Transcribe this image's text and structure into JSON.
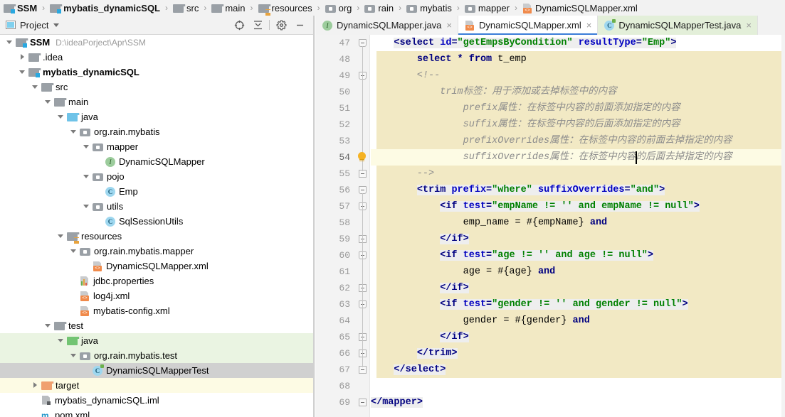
{
  "breadcrumb": {
    "items": [
      {
        "label": "SSM",
        "icon": "module-icon",
        "bold": true
      },
      {
        "label": "mybatis_dynamicSQL",
        "icon": "module-icon",
        "bold": true
      },
      {
        "label": "src",
        "icon": "folder-icon",
        "bold": false
      },
      {
        "label": "main",
        "icon": "folder-icon",
        "bold": false
      },
      {
        "label": "resources",
        "icon": "resource-folder-icon",
        "bold": false
      },
      {
        "label": "org",
        "icon": "package-icon",
        "bold": false
      },
      {
        "label": "rain",
        "icon": "package-icon",
        "bold": false
      },
      {
        "label": "mybatis",
        "icon": "package-icon",
        "bold": false
      },
      {
        "label": "mapper",
        "icon": "package-icon",
        "bold": false
      },
      {
        "label": "DynamicSQLMapper.xml",
        "icon": "xml-file-icon",
        "bold": false
      }
    ],
    "separator": "›"
  },
  "tool_window": {
    "title": "Project",
    "actions": [
      {
        "name": "select-opened-file-icon"
      },
      {
        "name": "collapse-all-icon"
      },
      {
        "name": "settings-gear-icon"
      },
      {
        "name": "hide-icon"
      }
    ]
  },
  "tree": {
    "rows": [
      {
        "indent": 0,
        "arrow": "down",
        "icon": "module-icon",
        "label": "SSM",
        "bold": true,
        "path": "D:\\ideaPorject\\Apr\\SSM",
        "bg": "none"
      },
      {
        "indent": 1,
        "arrow": "right",
        "icon": "folder-icon",
        "label": ".idea",
        "bold": false,
        "path": "",
        "bg": "none"
      },
      {
        "indent": 1,
        "arrow": "down",
        "icon": "module-icon",
        "label": "mybatis_dynamicSQL",
        "bold": true,
        "path": "",
        "bg": "none"
      },
      {
        "indent": 2,
        "arrow": "down",
        "icon": "folder-icon",
        "label": "src",
        "bold": false,
        "path": "",
        "bg": "none"
      },
      {
        "indent": 3,
        "arrow": "down",
        "icon": "folder-icon",
        "label": "main",
        "bold": false,
        "path": "",
        "bg": "none"
      },
      {
        "indent": 4,
        "arrow": "down",
        "icon": "source-folder-icon",
        "label": "java",
        "bold": false,
        "path": "",
        "bg": "none"
      },
      {
        "indent": 5,
        "arrow": "down",
        "icon": "package-icon",
        "label": "org.rain.mybatis",
        "bold": false,
        "path": "",
        "bg": "none"
      },
      {
        "indent": 6,
        "arrow": "down",
        "icon": "package-icon",
        "label": "mapper",
        "bold": false,
        "path": "",
        "bg": "none"
      },
      {
        "indent": 7,
        "arrow": "none",
        "icon": "interface-icon",
        "label": "DynamicSQLMapper",
        "bold": false,
        "path": "",
        "bg": "none"
      },
      {
        "indent": 6,
        "arrow": "down",
        "icon": "package-icon",
        "label": "pojo",
        "bold": false,
        "path": "",
        "bg": "none"
      },
      {
        "indent": 7,
        "arrow": "none",
        "icon": "class-icon",
        "label": "Emp",
        "bold": false,
        "path": "",
        "bg": "none"
      },
      {
        "indent": 6,
        "arrow": "down",
        "icon": "package-icon",
        "label": "utils",
        "bold": false,
        "path": "",
        "bg": "none"
      },
      {
        "indent": 7,
        "arrow": "none",
        "icon": "class-icon",
        "label": "SqlSessionUtils",
        "bold": false,
        "path": "",
        "bg": "none"
      },
      {
        "indent": 4,
        "arrow": "down",
        "icon": "resource-folder-icon",
        "label": "resources",
        "bold": false,
        "path": "",
        "bg": "none"
      },
      {
        "indent": 5,
        "arrow": "down",
        "icon": "package-icon",
        "label": "org.rain.mybatis.mapper",
        "bold": false,
        "path": "",
        "bg": "none"
      },
      {
        "indent": 6,
        "arrow": "none",
        "icon": "xml-file-icon",
        "label": "DynamicSQLMapper.xml",
        "bold": false,
        "path": "",
        "bg": "none"
      },
      {
        "indent": 5,
        "arrow": "none",
        "icon": "properties-file-icon",
        "label": "jdbc.properties",
        "bold": false,
        "path": "",
        "bg": "none"
      },
      {
        "indent": 5,
        "arrow": "none",
        "icon": "xml-file-icon",
        "label": "log4j.xml",
        "bold": false,
        "path": "",
        "bg": "none"
      },
      {
        "indent": 5,
        "arrow": "none",
        "icon": "xml-file-icon",
        "label": "mybatis-config.xml",
        "bold": false,
        "path": "",
        "bg": "none"
      },
      {
        "indent": 3,
        "arrow": "down",
        "icon": "folder-icon",
        "label": "test",
        "bold": false,
        "path": "",
        "bg": "none"
      },
      {
        "indent": 4,
        "arrow": "down",
        "icon": "test-source-folder-icon",
        "label": "java",
        "bold": false,
        "path": "",
        "bg": "green"
      },
      {
        "indent": 5,
        "arrow": "down",
        "icon": "package-icon",
        "label": "org.rain.mybatis.test",
        "bold": false,
        "path": "",
        "bg": "green"
      },
      {
        "indent": 6,
        "arrow": "none",
        "icon": "test-class-icon",
        "label": "DynamicSQLMapperTest",
        "bold": false,
        "path": "",
        "bg": "selected"
      },
      {
        "indent": 2,
        "arrow": "right",
        "icon": "excluded-folder-icon",
        "label": "target",
        "bold": false,
        "path": "",
        "bg": "yellow"
      },
      {
        "indent": 2,
        "arrow": "none",
        "icon": "iml-file-icon",
        "label": "mybatis_dynamicSQL.iml",
        "bold": false,
        "path": "",
        "bg": "none"
      },
      {
        "indent": 2,
        "arrow": "none",
        "icon": "maven-file-icon",
        "label": "pom.xml",
        "bold": false,
        "path": "",
        "bg": "none"
      }
    ]
  },
  "editor_tabs": [
    {
      "label": "DynamicSQLMapper.java",
      "icon": "interface-icon",
      "state": "inactive",
      "close": "×"
    },
    {
      "label": "DynamicSQLMapper.xml",
      "icon": "xml-file-icon",
      "state": "active",
      "close": "×"
    },
    {
      "label": "DynamicSQLMapperTest.java",
      "icon": "test-class-icon",
      "state": "highlight",
      "close": "×"
    }
  ],
  "editor": {
    "first_line_number": 47,
    "last_line_number": 69,
    "caret": {
      "line": 54,
      "column_label": ""
    },
    "intention_bulb_line": 54,
    "lines": [
      {
        "n": 47,
        "text": "    <select id=\"getEmpsByCondition\" resultType=\"Emp\">"
      },
      {
        "n": 48,
        "text": "        select * from t_emp"
      },
      {
        "n": 49,
        "text": "        <!--"
      },
      {
        "n": 50,
        "text": "            trim标签：用于添加或去掉标签中的内容"
      },
      {
        "n": 51,
        "text": "                prefix属性：在标签中内容的前面添加指定的内容"
      },
      {
        "n": 52,
        "text": "                suffix属性：在标签中内容的后面添加指定的内容"
      },
      {
        "n": 53,
        "text": "                prefixOverrides属性：在标签中内容的前面去掉指定的内容"
      },
      {
        "n": 54,
        "text": "                suffixOverrides属性：在标签中内容的后面去掉指定的内容"
      },
      {
        "n": 55,
        "text": "        -->"
      },
      {
        "n": 56,
        "text": "        <trim prefix=\"where\" suffixOverrides=\"and\">"
      },
      {
        "n": 57,
        "text": "            <if test=\"empName != '' and empName != null\">"
      },
      {
        "n": 58,
        "text": "                emp_name = #{empName} and"
      },
      {
        "n": 59,
        "text": "            </if>"
      },
      {
        "n": 60,
        "text": "            <if test=\"age != '' and age != null\">"
      },
      {
        "n": 61,
        "text": "                age = #{age} and"
      },
      {
        "n": 62,
        "text": "            </if>"
      },
      {
        "n": 63,
        "text": "            <if test=\"gender != '' and gender != null\">"
      },
      {
        "n": 64,
        "text": "                gender = #{gender} and"
      },
      {
        "n": 65,
        "text": "            </if>"
      },
      {
        "n": 66,
        "text": "        </trim>"
      },
      {
        "n": 67,
        "text": "    </select>"
      },
      {
        "n": 68,
        "text": ""
      },
      {
        "n": 69,
        "text": "</mapper>"
      }
    ]
  },
  "colors": {
    "tag": "#000080",
    "attribute": "#0000c0",
    "attribute_value": "#008000",
    "comment": "#8c8c8c",
    "selection_block": "#f2e9c4",
    "caret_line": "#fdfbe4",
    "tree_selection": "#d0d0d0",
    "test_source_tint": "#eaf4e2",
    "excluded_tint": "#fdfbe4",
    "active_tab_underline": "#3b7dd8",
    "bulb": "#f5b223"
  }
}
